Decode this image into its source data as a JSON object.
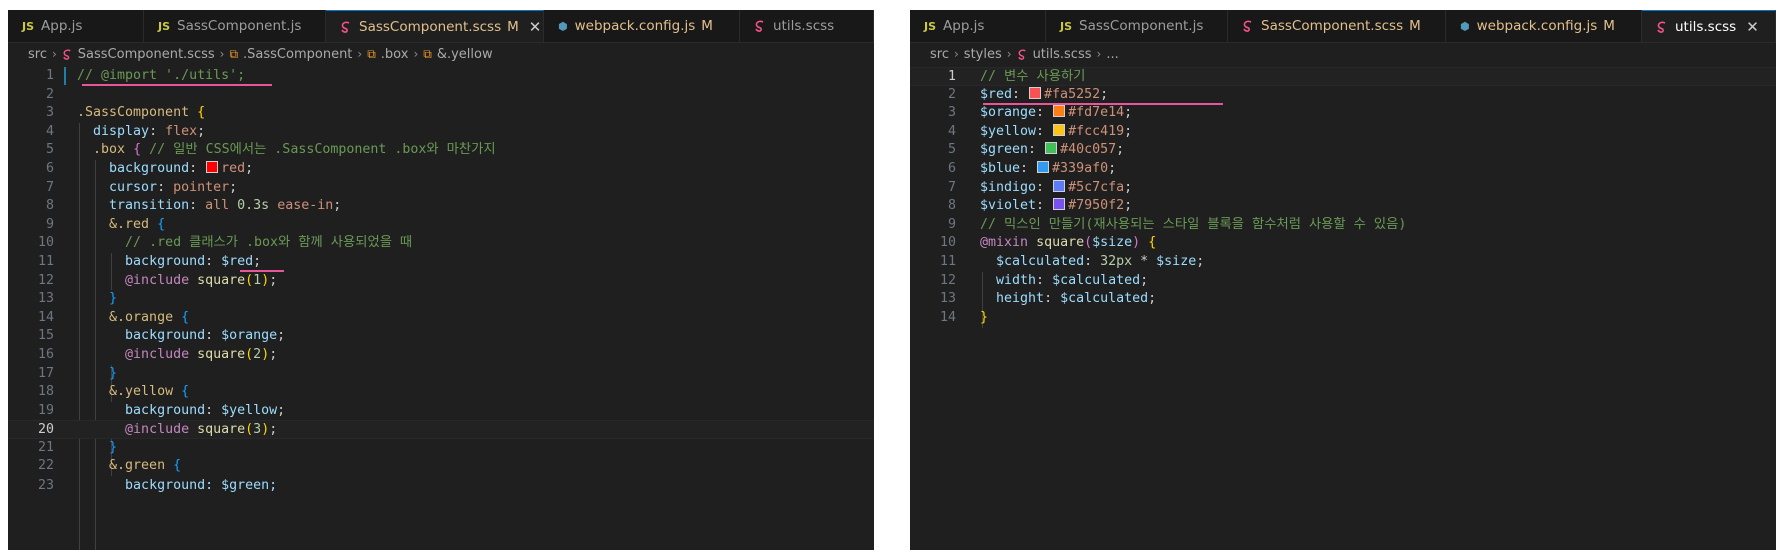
{
  "left": {
    "tabs": [
      {
        "label": "App.js",
        "icon": "js-icon",
        "modified": false,
        "active": false
      },
      {
        "label": "SassComponent.js",
        "icon": "js-icon",
        "modified": false,
        "active": false
      },
      {
        "label": "SassComponent.scss",
        "icon": "sass-icon",
        "modified": true,
        "active": true
      },
      {
        "label": "webpack.config.js",
        "icon": "webpack-icon",
        "modified": true,
        "active": false
      },
      {
        "label": "utils.scss",
        "icon": "sass-icon",
        "modified": false,
        "active": false
      }
    ],
    "breadcrumb": [
      "src",
      "SassComponent.scss",
      ".SassComponent",
      ".box",
      "&.yellow"
    ],
    "lines": [
      "1",
      "2",
      "3",
      "4",
      "5",
      "6",
      "7",
      "8",
      "9",
      "10",
      "11",
      "12",
      "13",
      "14",
      "15",
      "16",
      "17",
      "18",
      "19",
      "20",
      "21",
      "22"
    ],
    "current_line": "20",
    "code": {
      "l1": "// @import './utils';",
      "l3_sel": ".SassComponent",
      "l4_prop": "display",
      "l4_val": "flex",
      "l5_sel": ".box",
      "l5_comment": "// 일반 CSS에서는 .SassComponent .box와 마찬가지",
      "l6_prop": "background",
      "l6_val": "red",
      "l7_prop": "cursor",
      "l7_val": "pointer",
      "l8_prop": "transition",
      "l8_val": "all",
      "l8_num": "0.3s",
      "l8_ease": "ease-in",
      "l9_sel": "&.red",
      "l10_comment": "// .red 클래스가 .box와 함께 사용되었을 때",
      "l11_prop": "background",
      "l11_var": "$red",
      "l12_at": "@include",
      "l12_fn": "square",
      "l12_arg": "1",
      "l14_sel": "&.orange",
      "l15_prop": "background",
      "l15_var": "$orange",
      "l16_at": "@include",
      "l16_fn": "square",
      "l16_arg": "2",
      "l18_sel": "&.yellow",
      "l19_prop": "background",
      "l19_var": "$yellow",
      "l20_at": "@include",
      "l20_fn": "square",
      "l20_arg": "3",
      "l22_sel": "&.green",
      "l23_partial": "background: $green;"
    },
    "swatch_red": "#ff0000"
  },
  "right": {
    "tabs": [
      {
        "label": "App.js",
        "icon": "js-icon",
        "modified": false,
        "active": false
      },
      {
        "label": "SassComponent.js",
        "icon": "js-icon",
        "modified": false,
        "active": false
      },
      {
        "label": "SassComponent.scss",
        "icon": "sass-icon",
        "modified": true,
        "active": false
      },
      {
        "label": "webpack.config.js",
        "icon": "webpack-icon",
        "modified": true,
        "active": false
      },
      {
        "label": "utils.scss",
        "icon": "sass-icon",
        "modified": false,
        "active": true
      }
    ],
    "breadcrumb": [
      "src",
      "styles",
      "utils.scss",
      "..."
    ],
    "lines": [
      "1",
      "2",
      "3",
      "4",
      "5",
      "6",
      "7",
      "8",
      "9",
      "10",
      "11",
      "12",
      "13",
      "14"
    ],
    "current_line": "1",
    "code": {
      "l1_comment": "// 변수 사용하기",
      "vars": [
        {
          "name": "$red",
          "value": "#fa5252"
        },
        {
          "name": "$orange",
          "value": "#fd7e14"
        },
        {
          "name": "$yellow",
          "value": "#fcc419"
        },
        {
          "name": "$green",
          "value": "#40c057"
        },
        {
          "name": "$blue",
          "value": "#339af0"
        },
        {
          "name": "$indigo",
          "value": "#5c7cfa"
        },
        {
          "name": "$violet",
          "value": "#7950f2"
        }
      ],
      "l9_comment": "// 믹스인 만들기(재사용되는 스타일 블록을 함수처럼 사용할 수 있음)",
      "l10_at": "@mixin",
      "l10_fn": "square",
      "l10_param": "$size",
      "l11_var": "$calculated",
      "l11_num": "32px",
      "l11_op": "*",
      "l11_ref": "$size",
      "l12_prop": "width",
      "l12_var": "$calculated",
      "l13_prop": "height",
      "l13_var": "$calculated"
    }
  },
  "modified_marker": "M",
  "colors": {
    "editor_bg": "#1f1f1f",
    "tab_bg": "#181818",
    "annotation": "#e8569a",
    "comment": "#6a9955",
    "selector": "#d7ba7d",
    "property": "#9cdcfe"
  }
}
